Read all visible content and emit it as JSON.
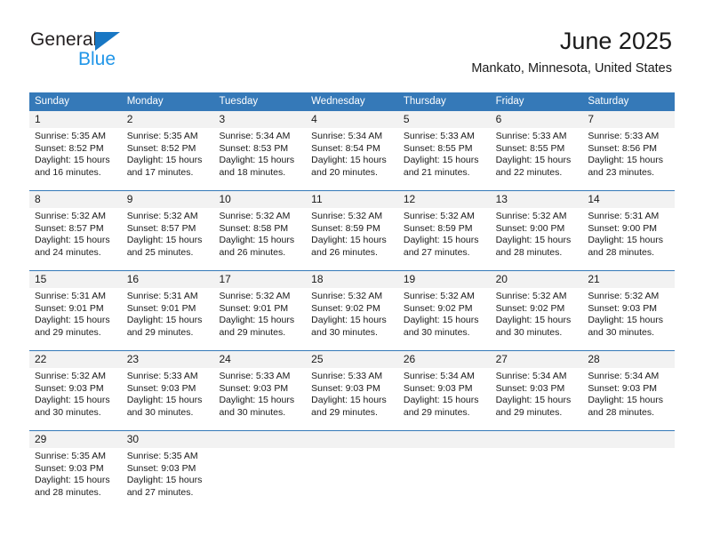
{
  "brand": {
    "name_top": "General",
    "name_bottom": "Blue",
    "accent_color": "#1877c4",
    "accent_color_light": "#2196e8"
  },
  "header": {
    "title": "June 2025",
    "subtitle": "Mankato, Minnesota, United States"
  },
  "theme": {
    "header_band": "#3579b8",
    "day_number_band": "#f2f2f2",
    "text": "#1a1a1a"
  },
  "calendar": {
    "weekday_headers": [
      "Sunday",
      "Monday",
      "Tuesday",
      "Wednesday",
      "Thursday",
      "Friday",
      "Saturday"
    ],
    "weeks": [
      {
        "days": [
          {
            "number": "1",
            "sunrise": "Sunrise: 5:35 AM",
            "sunset": "Sunset: 8:52 PM",
            "daylight_1": "Daylight: 15 hours",
            "daylight_2": "and 16 minutes."
          },
          {
            "number": "2",
            "sunrise": "Sunrise: 5:35 AM",
            "sunset": "Sunset: 8:52 PM",
            "daylight_1": "Daylight: 15 hours",
            "daylight_2": "and 17 minutes."
          },
          {
            "number": "3",
            "sunrise": "Sunrise: 5:34 AM",
            "sunset": "Sunset: 8:53 PM",
            "daylight_1": "Daylight: 15 hours",
            "daylight_2": "and 18 minutes."
          },
          {
            "number": "4",
            "sunrise": "Sunrise: 5:34 AM",
            "sunset": "Sunset: 8:54 PM",
            "daylight_1": "Daylight: 15 hours",
            "daylight_2": "and 20 minutes."
          },
          {
            "number": "5",
            "sunrise": "Sunrise: 5:33 AM",
            "sunset": "Sunset: 8:55 PM",
            "daylight_1": "Daylight: 15 hours",
            "daylight_2": "and 21 minutes."
          },
          {
            "number": "6",
            "sunrise": "Sunrise: 5:33 AM",
            "sunset": "Sunset: 8:55 PM",
            "daylight_1": "Daylight: 15 hours",
            "daylight_2": "and 22 minutes."
          },
          {
            "number": "7",
            "sunrise": "Sunrise: 5:33 AM",
            "sunset": "Sunset: 8:56 PM",
            "daylight_1": "Daylight: 15 hours",
            "daylight_2": "and 23 minutes."
          }
        ]
      },
      {
        "days": [
          {
            "number": "8",
            "sunrise": "Sunrise: 5:32 AM",
            "sunset": "Sunset: 8:57 PM",
            "daylight_1": "Daylight: 15 hours",
            "daylight_2": "and 24 minutes."
          },
          {
            "number": "9",
            "sunrise": "Sunrise: 5:32 AM",
            "sunset": "Sunset: 8:57 PM",
            "daylight_1": "Daylight: 15 hours",
            "daylight_2": "and 25 minutes."
          },
          {
            "number": "10",
            "sunrise": "Sunrise: 5:32 AM",
            "sunset": "Sunset: 8:58 PM",
            "daylight_1": "Daylight: 15 hours",
            "daylight_2": "and 26 minutes."
          },
          {
            "number": "11",
            "sunrise": "Sunrise: 5:32 AM",
            "sunset": "Sunset: 8:59 PM",
            "daylight_1": "Daylight: 15 hours",
            "daylight_2": "and 26 minutes."
          },
          {
            "number": "12",
            "sunrise": "Sunrise: 5:32 AM",
            "sunset": "Sunset: 8:59 PM",
            "daylight_1": "Daylight: 15 hours",
            "daylight_2": "and 27 minutes."
          },
          {
            "number": "13",
            "sunrise": "Sunrise: 5:32 AM",
            "sunset": "Sunset: 9:00 PM",
            "daylight_1": "Daylight: 15 hours",
            "daylight_2": "and 28 minutes."
          },
          {
            "number": "14",
            "sunrise": "Sunrise: 5:31 AM",
            "sunset": "Sunset: 9:00 PM",
            "daylight_1": "Daylight: 15 hours",
            "daylight_2": "and 28 minutes."
          }
        ]
      },
      {
        "days": [
          {
            "number": "15",
            "sunrise": "Sunrise: 5:31 AM",
            "sunset": "Sunset: 9:01 PM",
            "daylight_1": "Daylight: 15 hours",
            "daylight_2": "and 29 minutes."
          },
          {
            "number": "16",
            "sunrise": "Sunrise: 5:31 AM",
            "sunset": "Sunset: 9:01 PM",
            "daylight_1": "Daylight: 15 hours",
            "daylight_2": "and 29 minutes."
          },
          {
            "number": "17",
            "sunrise": "Sunrise: 5:32 AM",
            "sunset": "Sunset: 9:01 PM",
            "daylight_1": "Daylight: 15 hours",
            "daylight_2": "and 29 minutes."
          },
          {
            "number": "18",
            "sunrise": "Sunrise: 5:32 AM",
            "sunset": "Sunset: 9:02 PM",
            "daylight_1": "Daylight: 15 hours",
            "daylight_2": "and 30 minutes."
          },
          {
            "number": "19",
            "sunrise": "Sunrise: 5:32 AM",
            "sunset": "Sunset: 9:02 PM",
            "daylight_1": "Daylight: 15 hours",
            "daylight_2": "and 30 minutes."
          },
          {
            "number": "20",
            "sunrise": "Sunrise: 5:32 AM",
            "sunset": "Sunset: 9:02 PM",
            "daylight_1": "Daylight: 15 hours",
            "daylight_2": "and 30 minutes."
          },
          {
            "number": "21",
            "sunrise": "Sunrise: 5:32 AM",
            "sunset": "Sunset: 9:03 PM",
            "daylight_1": "Daylight: 15 hours",
            "daylight_2": "and 30 minutes."
          }
        ]
      },
      {
        "days": [
          {
            "number": "22",
            "sunrise": "Sunrise: 5:32 AM",
            "sunset": "Sunset: 9:03 PM",
            "daylight_1": "Daylight: 15 hours",
            "daylight_2": "and 30 minutes."
          },
          {
            "number": "23",
            "sunrise": "Sunrise: 5:33 AM",
            "sunset": "Sunset: 9:03 PM",
            "daylight_1": "Daylight: 15 hours",
            "daylight_2": "and 30 minutes."
          },
          {
            "number": "24",
            "sunrise": "Sunrise: 5:33 AM",
            "sunset": "Sunset: 9:03 PM",
            "daylight_1": "Daylight: 15 hours",
            "daylight_2": "and 30 minutes."
          },
          {
            "number": "25",
            "sunrise": "Sunrise: 5:33 AM",
            "sunset": "Sunset: 9:03 PM",
            "daylight_1": "Daylight: 15 hours",
            "daylight_2": "and 29 minutes."
          },
          {
            "number": "26",
            "sunrise": "Sunrise: 5:34 AM",
            "sunset": "Sunset: 9:03 PM",
            "daylight_1": "Daylight: 15 hours",
            "daylight_2": "and 29 minutes."
          },
          {
            "number": "27",
            "sunrise": "Sunrise: 5:34 AM",
            "sunset": "Sunset: 9:03 PM",
            "daylight_1": "Daylight: 15 hours",
            "daylight_2": "and 29 minutes."
          },
          {
            "number": "28",
            "sunrise": "Sunrise: 5:34 AM",
            "sunset": "Sunset: 9:03 PM",
            "daylight_1": "Daylight: 15 hours",
            "daylight_2": "and 28 minutes."
          }
        ]
      },
      {
        "days": [
          {
            "number": "29",
            "sunrise": "Sunrise: 5:35 AM",
            "sunset": "Sunset: 9:03 PM",
            "daylight_1": "Daylight: 15 hours",
            "daylight_2": "and 28 minutes."
          },
          {
            "number": "30",
            "sunrise": "Sunrise: 5:35 AM",
            "sunset": "Sunset: 9:03 PM",
            "daylight_1": "Daylight: 15 hours",
            "daylight_2": "and 27 minutes."
          },
          {
            "number": "",
            "sunrise": "",
            "sunset": "",
            "daylight_1": "",
            "daylight_2": ""
          },
          {
            "number": "",
            "sunrise": "",
            "sunset": "",
            "daylight_1": "",
            "daylight_2": ""
          },
          {
            "number": "",
            "sunrise": "",
            "sunset": "",
            "daylight_1": "",
            "daylight_2": ""
          },
          {
            "number": "",
            "sunrise": "",
            "sunset": "",
            "daylight_1": "",
            "daylight_2": ""
          },
          {
            "number": "",
            "sunrise": "",
            "sunset": "",
            "daylight_1": "",
            "daylight_2": ""
          }
        ]
      }
    ]
  }
}
